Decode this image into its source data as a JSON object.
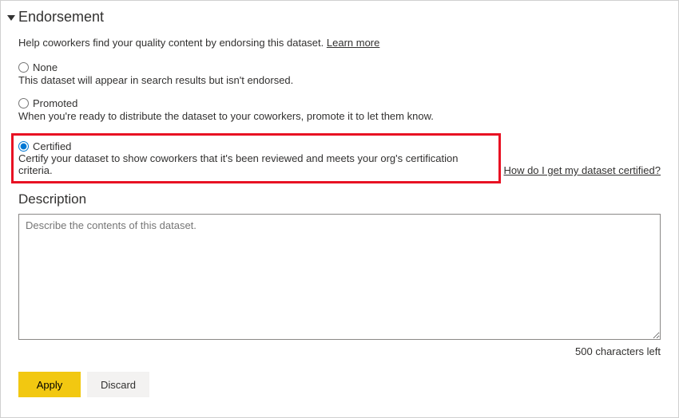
{
  "section": {
    "title": "Endorsement",
    "help_text": "Help coworkers find your quality content by endorsing this dataset. ",
    "learn_more": "Learn more"
  },
  "options": {
    "none": {
      "label": "None",
      "desc": "This dataset will appear in search results but isn't endorsed."
    },
    "promoted": {
      "label": "Promoted",
      "desc": "When you're ready to distribute the dataset to your coworkers, promote it to let them know."
    },
    "certified": {
      "label": "Certified",
      "desc": "Certify your dataset to show coworkers that it's been reviewed and meets your org's certification criteria. ",
      "link": "How do I get my dataset certified?"
    }
  },
  "description": {
    "header": "Description",
    "placeholder": "Describe the contents of this dataset.",
    "char_count": "500 characters left"
  },
  "buttons": {
    "apply": "Apply",
    "discard": "Discard"
  }
}
